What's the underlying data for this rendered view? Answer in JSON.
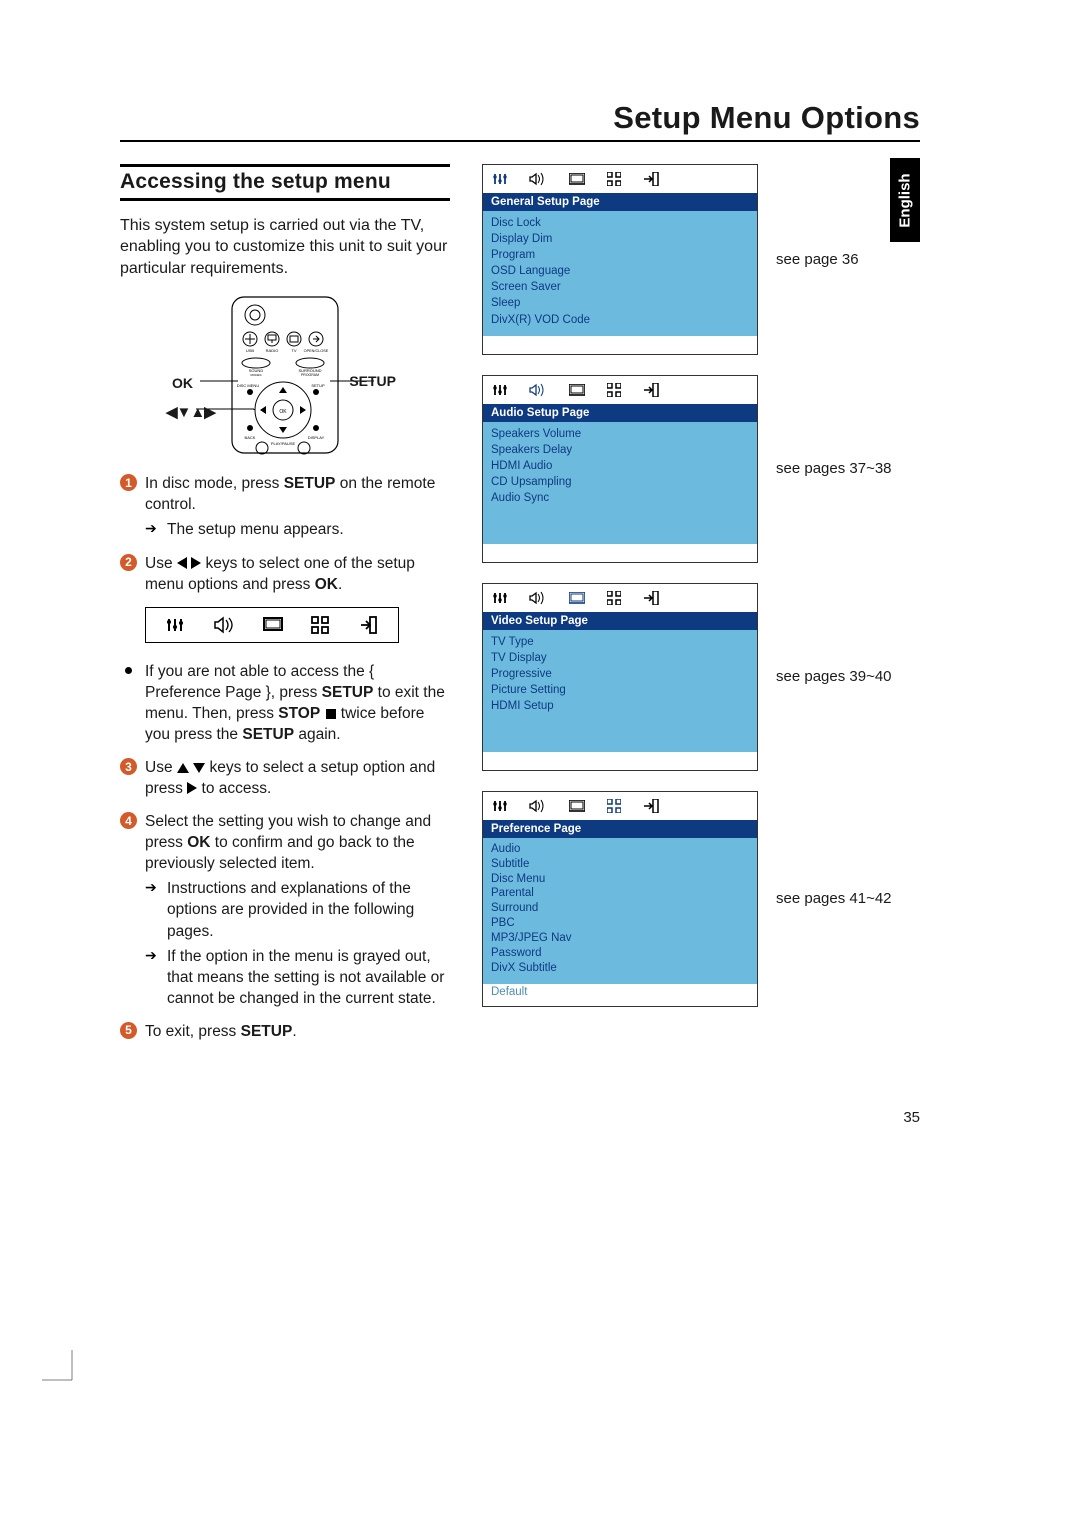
{
  "page_title": "Setup Menu Options",
  "language_tab": "English",
  "page_number": "35",
  "section_heading": "Accessing the setup menu",
  "intro": "This system setup is carried out via the TV, enabling you to customize this unit to suit your particular requirements.",
  "remote_labels": {
    "ok": "OK",
    "setup": "SETUP",
    "arrows": "◀▼▲▶"
  },
  "remote_button_text": {
    "usb": "USB",
    "radio": "RADIO",
    "tv": "TV",
    "openclose": "OPEN/CLOSE",
    "sound": "SOUND",
    "surround": "SURROUND",
    "program": "PROGRAM",
    "discmenu": "DISC MENU",
    "setup": "SETUP",
    "back": "BACK",
    "display": "DISPLAY",
    "playpause": "PLAY/PAUSE",
    "ok": "OK"
  },
  "steps": {
    "s1": {
      "num": "1",
      "text_a": "In disc mode, press ",
      "bold": "SETUP",
      "text_b": " on the remote control.",
      "sub": "The setup menu appears."
    },
    "s2": {
      "num": "2",
      "text_a": "Use ",
      "text_b": " keys to select one of the setup menu options and press ",
      "bold": "OK",
      "text_c": "."
    },
    "bullet": {
      "t1": "If you are not able to access the { Preference Page }, press ",
      "b1": "SETUP",
      "t2": " to exit the menu.  Then, press ",
      "b2": "STOP",
      "t3": " twice before you press the ",
      "b3": "SETUP",
      "t4": " again."
    },
    "s3": {
      "num": "3",
      "text_a": "Use ",
      "text_b": " keys to select a setup option and press ",
      "text_c": " to access."
    },
    "s4": {
      "num": "4",
      "t1": "Select the setting you wish to change and press ",
      "b1": "OK",
      "t2": " to confirm and go back to the previously selected item.",
      "sub1": "Instructions and explanations of the options are provided in the following pages.",
      "sub2": "If the option in the menu is grayed out, that means the setting is not available or cannot be changed in the current state."
    },
    "s5": {
      "num": "5",
      "t1": "To exit, press ",
      "b1": "SETUP",
      "t2": "."
    }
  },
  "menus": {
    "general": {
      "header": "General Setup Page",
      "items": [
        "Disc Lock",
        "Display Dim",
        "Program",
        "OSD Language",
        "Screen Saver",
        "Sleep",
        "DivX(R) VOD Code"
      ],
      "see": "see page 36"
    },
    "audio": {
      "header": "Audio Setup Page",
      "items": [
        "Speakers Volume",
        "Speakers Delay",
        "HDMI Audio",
        "CD Upsampling",
        "Audio Sync"
      ],
      "see": "see pages 37~38"
    },
    "video": {
      "header": "Video Setup Page",
      "items": [
        "TV Type",
        "TV Display",
        "Progressive",
        "Picture Setting",
        "HDMI Setup"
      ],
      "see": "see pages 39~40"
    },
    "preference": {
      "header": "Preference Page",
      "items": [
        "Audio",
        "Subtitle",
        "Disc Menu",
        "Parental",
        "Surround",
        "PBC",
        "MP3/JPEG Nav",
        "Password",
        "DivX Subtitle"
      ],
      "dimmed": "Default",
      "see": "see pages 41~42"
    }
  },
  "icon_names": [
    "sliders-icon",
    "speaker-icon",
    "screen-icon",
    "grid-icon",
    "exit-icon"
  ]
}
